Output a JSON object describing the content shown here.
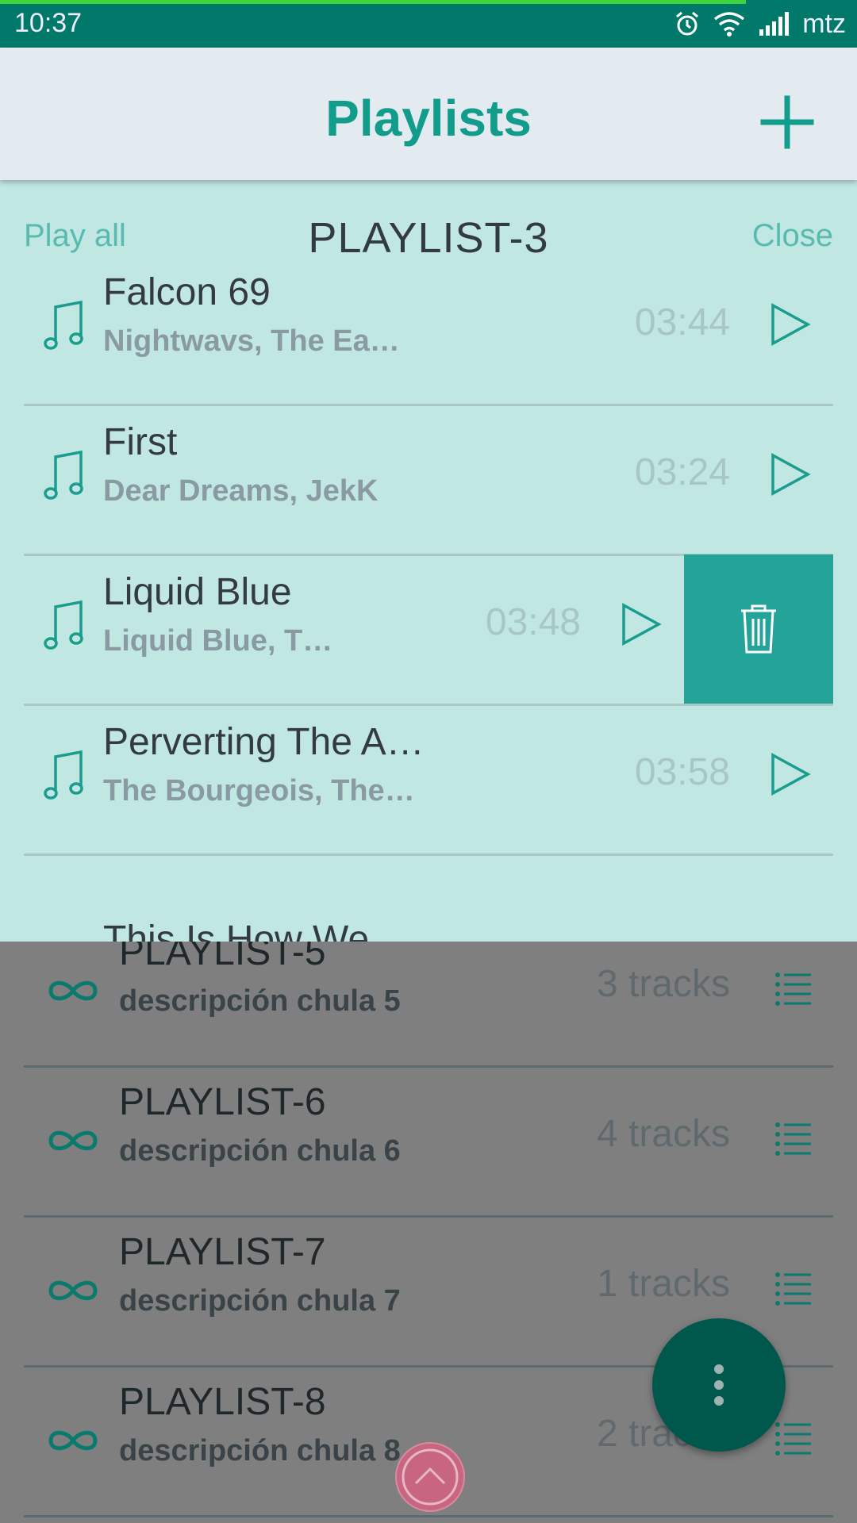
{
  "status_bar": {
    "time": "10:37",
    "carrier": "mtz"
  },
  "app_bar": {
    "title": "Playlists"
  },
  "open_playlist": {
    "play_all_label": "Play all",
    "name": "PLAYLIST-3",
    "close_label": "Close",
    "tracks": [
      {
        "title": "Falcon 69",
        "artist": "Nightwavs, The Ea…",
        "duration": "03:44"
      },
      {
        "title": "First",
        "artist": "Dear Dreams, JekK",
        "duration": "03:24"
      },
      {
        "title": "Liquid Blue",
        "artist": "Liquid Blue, T…",
        "duration": "03:48",
        "swiped": true
      },
      {
        "title": "Perverting The A…",
        "artist": "The Bourgeois, The…",
        "duration": "03:58"
      },
      {
        "title": "This Is How We",
        "artist": "",
        "duration": ""
      }
    ]
  },
  "playlists": [
    {
      "name": "PLAYLIST-5",
      "description": "descripción chula 5",
      "tracks": "3 tracks"
    },
    {
      "name": "PLAYLIST-6",
      "description": "descripción chula 6",
      "tracks": "4 tracks"
    },
    {
      "name": "PLAYLIST-7",
      "description": "descripción chula 7",
      "tracks": "1 tracks"
    },
    {
      "name": "PLAYLIST-8",
      "description": "descripción chula 8",
      "tracks": "2 tracks"
    }
  ],
  "icons": {
    "add": "plus-icon",
    "track": "music-note-icon",
    "play": "play-icon",
    "delete": "trash-icon",
    "playlist": "infinity-icon",
    "open_list": "list-icon",
    "menu": "more-vertical-icon",
    "scroll_top": "chevron-up-icon"
  },
  "colors": {
    "accent": "#129c8c",
    "status_bar": "#00796b",
    "panel": "#c1e7e3",
    "delete": "#24a398",
    "fab": "#00574b"
  }
}
